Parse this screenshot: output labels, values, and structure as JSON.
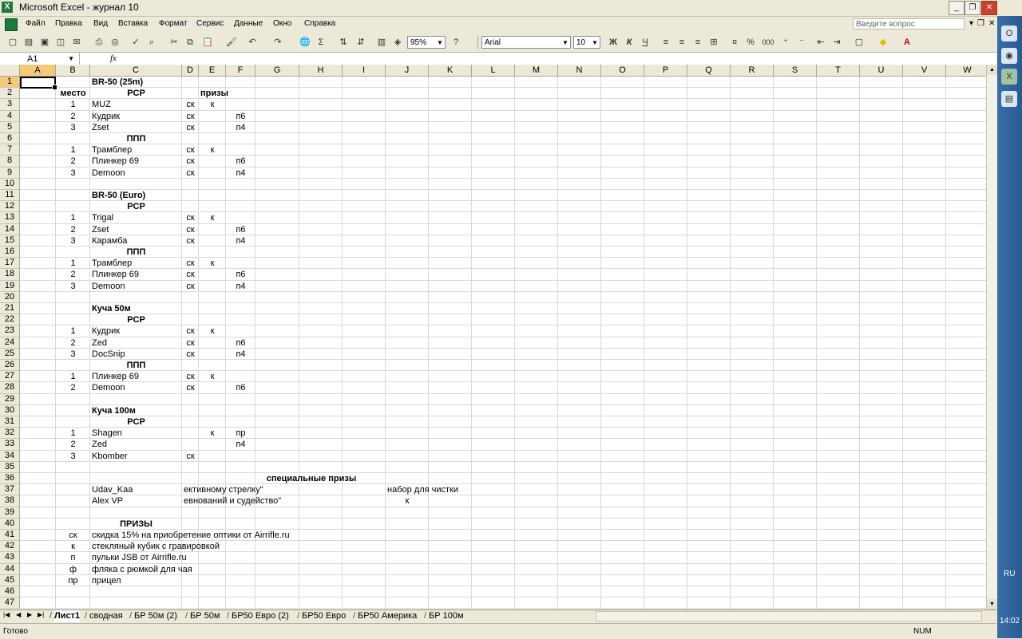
{
  "window": {
    "title": "Microsoft Excel - журнал 10",
    "app_icon": "excel-icon"
  },
  "menu": {
    "items": [
      "Файл",
      "Правка",
      "Вид",
      "Вставка",
      "Формат",
      "Сервис",
      "Данные",
      "Окно",
      "Справка"
    ],
    "help_placeholder": "Введите вопрос"
  },
  "toolbar": {
    "zoom": "95%",
    "font": "Arial",
    "font_size": "10",
    "bold": "Ж",
    "italic": "К",
    "underline": "Ч",
    "sum": "Σ",
    "percent": "%",
    "thousands": "000"
  },
  "formula_bar": {
    "cell_ref": "A1",
    "fx": "fx",
    "value": ""
  },
  "columns": [
    "A",
    "B",
    "C",
    "D",
    "E",
    "F",
    "G",
    "H",
    "I",
    "J",
    "K",
    "L",
    "M",
    "N",
    "O",
    "P",
    "Q",
    "R",
    "S",
    "T",
    "U",
    "V",
    "W"
  ],
  "rows": [
    {
      "A": "",
      "B": "",
      "C": "BR-50 (25m)",
      "D": "",
      "E": "",
      "F": ""
    },
    {
      "B": "место",
      "C": "PCP",
      "E": "призы"
    },
    {
      "B": "1",
      "C": "MUZ",
      "D": "ск",
      "E": "к"
    },
    {
      "B": "2",
      "C": "Кудрик",
      "D": "ск",
      "F": "п6"
    },
    {
      "B": "3",
      "C": "Zset",
      "D": "ск",
      "F": "п4"
    },
    {
      "C": "ППП"
    },
    {
      "B": "1",
      "C": "Трамблер",
      "D": "ск",
      "E": "к"
    },
    {
      "B": "2",
      "C": "Плинкер 69",
      "D": "ск",
      "F": "п6"
    },
    {
      "B": "3",
      "C": "Demoon",
      "D": "ск",
      "F": "п4"
    },
    {},
    {
      "C": "BR-50 (Euro)"
    },
    {
      "C": "PCP"
    },
    {
      "B": "1",
      "C": "Trigal",
      "D": "ск",
      "E": "к"
    },
    {
      "B": "2",
      "C": "Zset",
      "D": "ск",
      "F": "п6"
    },
    {
      "B": "3",
      "C": "Карамба",
      "D": "ск",
      "F": "п4"
    },
    {
      "C": "ППП"
    },
    {
      "B": "1",
      "C": "Трамблер",
      "D": "ск",
      "E": "к"
    },
    {
      "B": "2",
      "C": "Плинкер 69",
      "D": "ск",
      "F": "п6"
    },
    {
      "B": "3",
      "C": "Demoon",
      "D": "ск",
      "F": "п4"
    },
    {},
    {
      "C": "Куча 50м"
    },
    {
      "C": "PCP"
    },
    {
      "B": "1",
      "C": "Кудрик",
      "D": "ск",
      "E": "к"
    },
    {
      "B": "2",
      "C": "Zed",
      "D": "ск",
      "F": "п6"
    },
    {
      "B": "3",
      "C": "DocSnip",
      "D": "ск",
      "F": "п4"
    },
    {
      "C": "ППП"
    },
    {
      "B": "1",
      "C": "Плинкер 69",
      "D": "ск",
      "E": "к"
    },
    {
      "B": "2",
      "C": "Demoon",
      "D": "ск",
      "F": "п6"
    },
    {},
    {
      "C": "Куча 100м"
    },
    {
      "C": "PCP"
    },
    {
      "B": "1",
      "C": "Shagen",
      "E": "к",
      "F": "пр"
    },
    {
      "B": "2",
      "C": "Zed",
      "F": "п4"
    },
    {
      "B": "3",
      "C": "Kbomber",
      "D": "ск"
    },
    {},
    {
      "G": "специальные призы"
    },
    {
      "C": "Udav_Kaa",
      "D": "ективному стрелку\"",
      "J": "набор для чистки"
    },
    {
      "C": "Alex VP",
      "D": "евнований и судейство\"",
      "J": "к"
    },
    {},
    {
      "C": "ПРИЗЫ"
    },
    {
      "B": "ск",
      "C": "скидка 15%  на приобретение оптики от Airrifle.ru"
    },
    {
      "B": "к",
      "C": "стекляный кубик с гравировкой"
    },
    {
      "B": "п",
      "C": "пульки JSB от Airrifle.ru"
    },
    {
      "B": "ф",
      "C": "фляка с рюмкой для чая"
    },
    {
      "B": "пр",
      "C": "прицел"
    },
    {},
    {}
  ],
  "sheets": [
    "Лист1",
    "сводная",
    "БР 50м (2)",
    "БР 50м",
    "БР50 Евро (2)",
    "БР50 Евро",
    "БР50 Америка",
    "БР 100м"
  ],
  "status": {
    "text": "Готово",
    "num": "NUM"
  },
  "taskbar": {
    "lang": "RU",
    "clock": "14:02"
  }
}
